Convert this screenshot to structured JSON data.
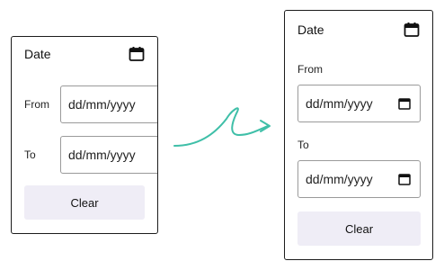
{
  "left_card": {
    "title": "Date",
    "from_label": "From",
    "from_value": "dd/mm/yyyy",
    "to_label": "To",
    "to_value": "dd/mm/yyyy",
    "clear_label": "Clear"
  },
  "right_card": {
    "title": "Date",
    "from_label": "From",
    "from_value": "dd/mm/yyyy",
    "to_label": "To",
    "to_value": "dd/mm/yyyy",
    "clear_label": "Clear"
  },
  "icons": {
    "header": "calendar-icon",
    "input": "calendar-icon",
    "transition": "curly-arrow-icon"
  },
  "colors": {
    "arrow": "#3fbfa8",
    "button_bg": "#efedf6",
    "border": "#1c1c1c"
  }
}
